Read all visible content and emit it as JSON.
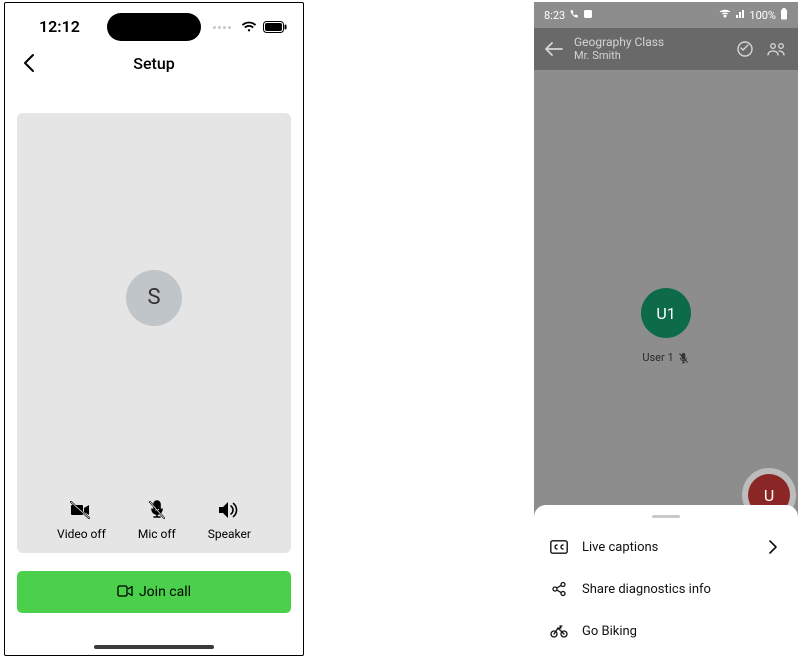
{
  "left": {
    "status_time": "12:12",
    "header_title": "Setup",
    "avatar_initial": "S",
    "controls": {
      "video_label": "Video off",
      "mic_label": "Mic off",
      "speaker_label": "Speaker"
    },
    "join_label": "Join call"
  },
  "right": {
    "status_time": "8:23",
    "battery_text": "100%",
    "header": {
      "title": "Geography Class",
      "subtitle": "Mr. Smith"
    },
    "participant": {
      "avatar_initials": "U1",
      "name": "User 1"
    },
    "fab_initial": "U",
    "sheet": {
      "item1": "Live captions",
      "item2": "Share diagnostics info",
      "item3": "Go Biking"
    }
  }
}
